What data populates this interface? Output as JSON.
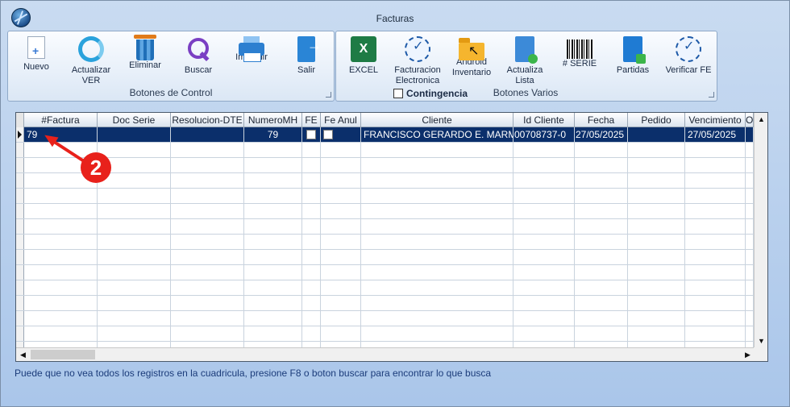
{
  "window": {
    "title": "Facturas"
  },
  "ribbon": {
    "control_group": {
      "label": "Botones de Control",
      "buttons": [
        {
          "label": "Nuevo",
          "icon": "new-document-icon"
        },
        {
          "label": "Actualizar\nVER",
          "icon": "refresh-icon"
        },
        {
          "label": "Eliminar",
          "icon": "trash-icon"
        },
        {
          "label": "Buscar",
          "icon": "search-icon"
        },
        {
          "label": "Imprimir",
          "icon": "printer-icon"
        },
        {
          "label": "Salir",
          "icon": "exit-icon"
        }
      ]
    },
    "varios_group": {
      "label": "Botones Varios",
      "buttons": [
        {
          "label": "EXCEL",
          "icon": "excel-icon"
        },
        {
          "label": "Facturacion\nElectronica",
          "icon": "e-invoice-seal-icon"
        },
        {
          "label": "Android\nInventario",
          "icon": "android-folder-icon"
        },
        {
          "label": "Actualiza\nLista",
          "icon": "update-list-icon"
        },
        {
          "label": "# SERIE",
          "icon": "barcode-icon"
        },
        {
          "label": "Partidas",
          "icon": "partidas-icon"
        },
        {
          "label": "Verificar FE",
          "icon": "verify-seal-icon"
        }
      ],
      "contingencia_label": "Contingencia"
    }
  },
  "grid": {
    "columns": [
      "#Factura",
      "Doc Serie",
      "Resolucion-DTE",
      "NumeroMH",
      "FE",
      "Fe Anul",
      "Cliente",
      "Id Cliente",
      "Fecha",
      "Pedido",
      "Vencimiento",
      "O"
    ],
    "rows": [
      {
        "factura": "79",
        "doc_serie": "",
        "resolucion": "",
        "numero_mh": "79",
        "fe": false,
        "fe_anul": false,
        "cliente": "FRANCISCO GERARDO E. MARMOL",
        "id_cliente": "00708737-0",
        "fecha": "27/05/2025",
        "pedido": "",
        "vencimiento": "27/05/2025"
      }
    ]
  },
  "status": {
    "message": "Puede que no vea todos los registros en la cuadricula, presione F8 o boton buscar para encontrar lo que busca"
  },
  "annotation": {
    "badge": "2"
  },
  "colors": {
    "selected_row": "#0b2f6b",
    "annotation": "#e8211b",
    "background": "#aac6ea"
  }
}
